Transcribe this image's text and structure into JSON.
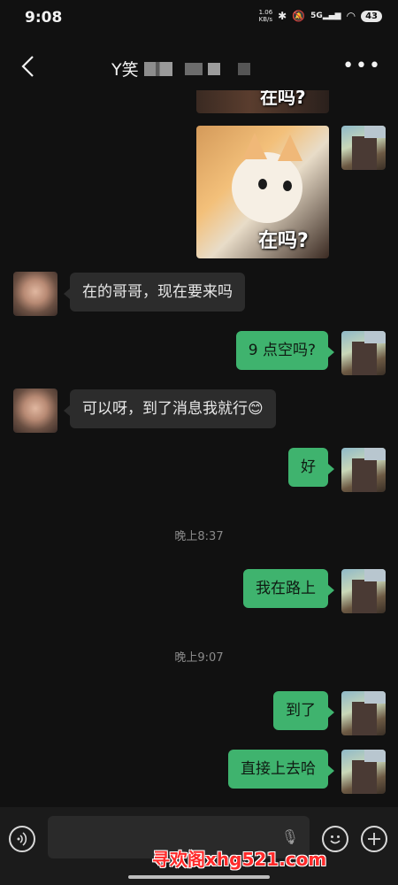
{
  "status_bar": {
    "time": "9:08",
    "net_speed_value": "1.06",
    "net_speed_unit": "KB/s",
    "signal_label": "5G",
    "battery": "43"
  },
  "header": {
    "title_prefix": "Y笑"
  },
  "messages": [
    {
      "side": "out",
      "type": "sticker",
      "caption": "在吗?"
    },
    {
      "side": "out",
      "type": "sticker",
      "caption": "在吗?"
    },
    {
      "side": "in",
      "type": "text",
      "text": "在的哥哥，现在要来吗"
    },
    {
      "side": "out",
      "type": "text",
      "text": "9 点空吗?"
    },
    {
      "side": "in",
      "type": "text",
      "text": "可以呀，到了消息我就行😊"
    },
    {
      "side": "out",
      "type": "text",
      "text": "好"
    },
    {
      "type": "time",
      "text": "晚上8:37"
    },
    {
      "side": "out",
      "type": "text",
      "text": "我在路上"
    },
    {
      "type": "time",
      "text": "晚上9:07"
    },
    {
      "side": "out",
      "type": "text",
      "text": "到了"
    },
    {
      "side": "out",
      "type": "text",
      "text": "直接上去哈"
    }
  ],
  "watermark": "寻欢阁xhg521.com",
  "colors": {
    "background": "#111111",
    "bubble_out": "#3fb36e",
    "bubble_in": "#2c2c2c",
    "watermark": "#ff2a2a"
  },
  "icons": {
    "back": "chevron-left-icon",
    "more": "more-dots-icon",
    "voice": "voice-icon",
    "mic": "microphone-icon",
    "emoji": "emoji-icon",
    "plus": "plus-icon"
  }
}
